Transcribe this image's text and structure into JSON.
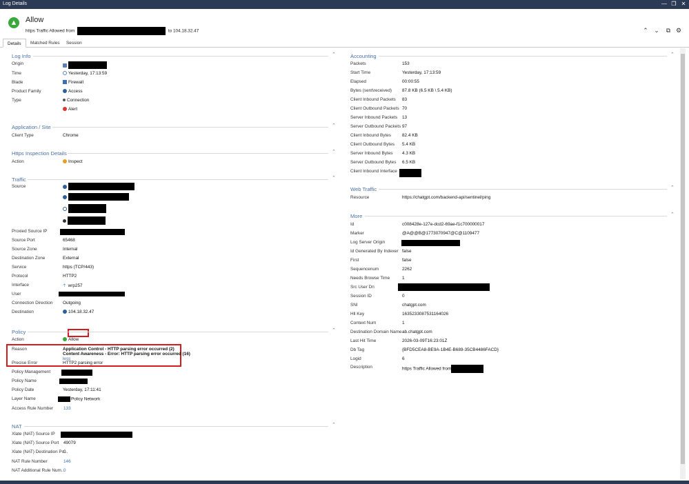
{
  "window": {
    "title": "Log Details"
  },
  "header": {
    "title": "Allow",
    "subtitle_prefix": "https Traffic Allowed from",
    "subtitle_suffix": "to 104.18.32.47"
  },
  "tabs": [
    "Details",
    "Matched Rules",
    "Session"
  ],
  "log_info": {
    "title": "Log Info",
    "rows": [
      {
        "label": "Origin",
        "value": ""
      },
      {
        "label": "Time",
        "value": "Yesterday, 17:13:59"
      },
      {
        "label": "Blade",
        "value": "Firewall"
      },
      {
        "label": "Product Family",
        "value": "Access"
      },
      {
        "label": "Type",
        "value": "Connection"
      },
      {
        "label": "",
        "value": "Alert"
      }
    ]
  },
  "application_site": {
    "title": "Application / Site",
    "rows": [
      {
        "label": "Client Type",
        "value": "Chrome"
      }
    ]
  },
  "https_inspection": {
    "title": "Https Inspection Details",
    "rows": [
      {
        "label": "Action",
        "value": "Inspect"
      }
    ]
  },
  "traffic": {
    "title": "Traffic",
    "rows": [
      {
        "label": "Source",
        "value": ""
      },
      {
        "label": "Proxied Source IP",
        "value": ""
      },
      {
        "label": "Source Port",
        "value": "65468"
      },
      {
        "label": "Source Zone",
        "value": "Internal"
      },
      {
        "label": "Destination Zone",
        "value": "External"
      },
      {
        "label": "Service",
        "value": "https (TCP/443)"
      },
      {
        "label": "Protocol",
        "value": "HTTP2"
      },
      {
        "label": "Interface",
        "value": "wrp257"
      },
      {
        "label": "User",
        "value": ""
      },
      {
        "label": "Connection Direction",
        "value": "Outgoing"
      },
      {
        "label": "Destination",
        "value": "104.18.32.47"
      }
    ]
  },
  "policy": {
    "title": "Policy",
    "rows": [
      {
        "label": "Action",
        "value": "Allow"
      },
      {
        "label": "Reason",
        "value": "Application Control  -  HTTP parsing error occurred (2)",
        "value2": "Content Awareness  -  Error: HTTP parsing error occurred (16)",
        "more": "less"
      },
      {
        "label": "Precise Error",
        "value": "HTTP2 parsing error"
      },
      {
        "label": "Policy Management",
        "value": ""
      },
      {
        "label": "Policy Name",
        "value": ""
      },
      {
        "label": "Policy Date",
        "value": "Yesterday, 17:11:41"
      },
      {
        "label": "Layer Name",
        "value": "Policy Network"
      },
      {
        "label": "Access Rule Number",
        "value": "133"
      }
    ]
  },
  "nat": {
    "title": "NAT",
    "rows": [
      {
        "label": "Xlate (NAT) Source IP",
        "value": ""
      },
      {
        "label": "Xlate (NAT) Source Port",
        "value": "49079"
      },
      {
        "label": "Xlate (NAT) Destination Po...",
        "value": "0"
      },
      {
        "label": "NAT Rule Number",
        "value": "146"
      },
      {
        "label": "NAT Additional Rule Num...",
        "value": "0"
      }
    ]
  },
  "accounting": {
    "title": "Accounting",
    "rows": [
      {
        "label": "Packets",
        "value": "153"
      },
      {
        "label": "Start Time",
        "value": "Yesterday, 17:13:59"
      },
      {
        "label": "Elapsed",
        "value": "00:00:55"
      },
      {
        "label": "Bytes (sent\\received)",
        "value": "87.8 KB (6.5 KB \\ 5.4 KB)"
      },
      {
        "label": "Client Inbound Packets",
        "value": "83"
      },
      {
        "label": "Client Outbound Packets",
        "value": "70"
      },
      {
        "label": "Server Inbound Packets",
        "value": "13"
      },
      {
        "label": "Server Outbound Packets",
        "value": "97"
      },
      {
        "label": "Client Inbound Bytes",
        "value": "82.4 KB"
      },
      {
        "label": "Client Outbound Bytes",
        "value": "5.4 KB"
      },
      {
        "label": "Server Inbound Bytes",
        "value": "4.3 KB"
      },
      {
        "label": "Server Outbound Bytes",
        "value": "6.5 KB"
      },
      {
        "label": "Client Inbound Interface",
        "value": ""
      }
    ]
  },
  "web_traffic": {
    "title": "Web Traffic",
    "rows": [
      {
        "label": "Resource",
        "value": "https://chatgpt.com/backend-api/sentinel/ping"
      }
    ]
  },
  "more": {
    "title": "More",
    "rows": [
      {
        "label": "Id",
        "value": "c008428e-127e-dcd2-69ae-f1c700000017"
      },
      {
        "label": "Marker",
        "value": "@A@@B@1773070947@C@1109477"
      },
      {
        "label": "Log Server Origin",
        "value": ""
      },
      {
        "label": "Id Generated By Indexer",
        "value": "false"
      },
      {
        "label": "First",
        "value": "false"
      },
      {
        "label": "Sequencenum",
        "value": "2262"
      },
      {
        "label": "Needs Browse Time",
        "value": "1"
      },
      {
        "label": "Src User Dn",
        "value": ""
      },
      {
        "label": "Session ID",
        "value": "0"
      },
      {
        "label": "SNI",
        "value": "chatgpt.com"
      },
      {
        "label": "Hll Key",
        "value": "1635233087531164026"
      },
      {
        "label": "Context Num",
        "value": "1"
      },
      {
        "label": "Destination Domain Name",
        "value": "ab.chatgpt.com"
      },
      {
        "label": "Last Hit Time",
        "value": "2026-03-09T16:23:01Z"
      },
      {
        "label": "Db Tag",
        "value": "{BFD5CEA8-BE9A-1B4E-B689-35CB4486FACD}"
      },
      {
        "label": "Logid",
        "value": "6"
      },
      {
        "label": "Description",
        "value": "https Traffic Allowed from"
      }
    ]
  },
  "colors": {
    "accent": "#4a6fa5",
    "allow": "#3aa83a",
    "highlight": "#d41a1a",
    "link": "#3c6eb4"
  }
}
